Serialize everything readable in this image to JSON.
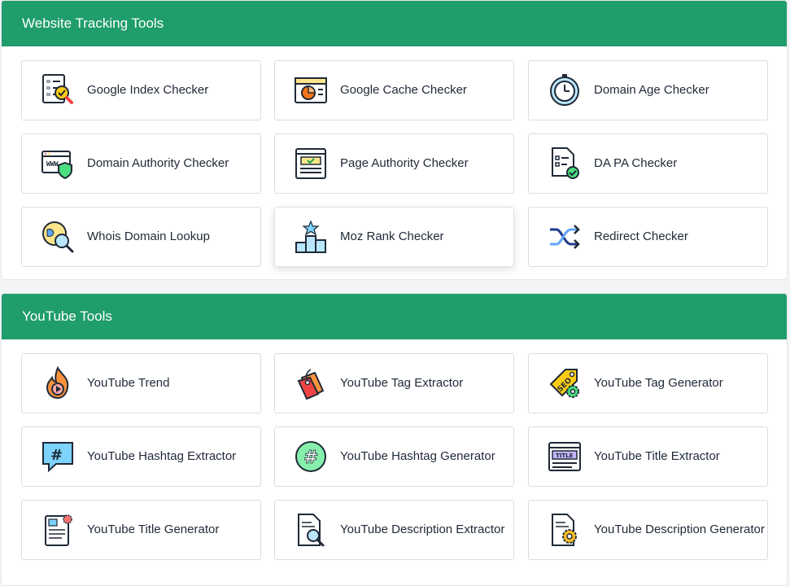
{
  "sections": [
    {
      "title": "Website Tracking Tools",
      "tools": [
        {
          "label": "Google Index Checker",
          "icon": "index-checklist-icon"
        },
        {
          "label": "Google Cache Checker",
          "icon": "browser-pie-icon"
        },
        {
          "label": "Domain Age Checker",
          "icon": "stopwatch-icon"
        },
        {
          "label": "Domain Authority Checker",
          "icon": "www-shield-icon"
        },
        {
          "label": "Page Authority Checker",
          "icon": "webpage-check-icon"
        },
        {
          "label": "DA PA Checker",
          "icon": "document-check-icon"
        },
        {
          "label": "Whois Domain Lookup",
          "icon": "globe-magnifier-icon"
        },
        {
          "label": "Moz Rank Checker",
          "icon": "podium-star-icon"
        },
        {
          "label": "Redirect Checker",
          "icon": "shuffle-arrows-icon"
        }
      ]
    },
    {
      "title": "YouTube Tools",
      "tools": [
        {
          "label": "YouTube Trend",
          "icon": "flame-play-icon"
        },
        {
          "label": "YouTube Tag Extractor",
          "icon": "price-tag-icon"
        },
        {
          "label": "YouTube Tag Generator",
          "icon": "seo-tag-gear-icon"
        },
        {
          "label": "YouTube Hashtag Extractor",
          "icon": "hashtag-chat-icon"
        },
        {
          "label": "YouTube Hashtag Generator",
          "icon": "hashtag-circle-icon"
        },
        {
          "label": "YouTube Title Extractor",
          "icon": "title-window-icon"
        },
        {
          "label": "YouTube Title Generator",
          "icon": "document-gear-icon"
        },
        {
          "label": "YouTube Description Extractor",
          "icon": "document-magnifier-icon"
        },
        {
          "label": "YouTube Description Generator",
          "icon": "document-cog-icon"
        }
      ]
    }
  ]
}
